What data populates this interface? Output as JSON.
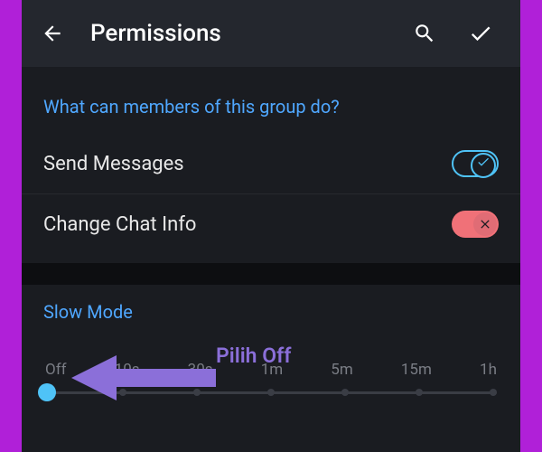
{
  "header": {
    "title": "Permissions"
  },
  "permissions": {
    "section_title": "What can members of this group do?",
    "items": [
      {
        "label": "Send Messages",
        "enabled": true
      },
      {
        "label": "Change Chat Info",
        "enabled": false
      }
    ]
  },
  "slowmode": {
    "title": "Slow Mode",
    "options": [
      "Off",
      "10s",
      "30s",
      "1m",
      "5m",
      "15m",
      "1h"
    ],
    "selected_index": 0
  },
  "annotation": {
    "label": "Pilih Off",
    "arrow_color": "#8b6fd9"
  },
  "colors": {
    "frame": "#b020d8",
    "bg": "#1a1c21",
    "header_bg": "#24272e",
    "accent_blue": "#4fc3f7",
    "link_blue": "#4fa7ff",
    "toggle_off": "#f07178"
  }
}
